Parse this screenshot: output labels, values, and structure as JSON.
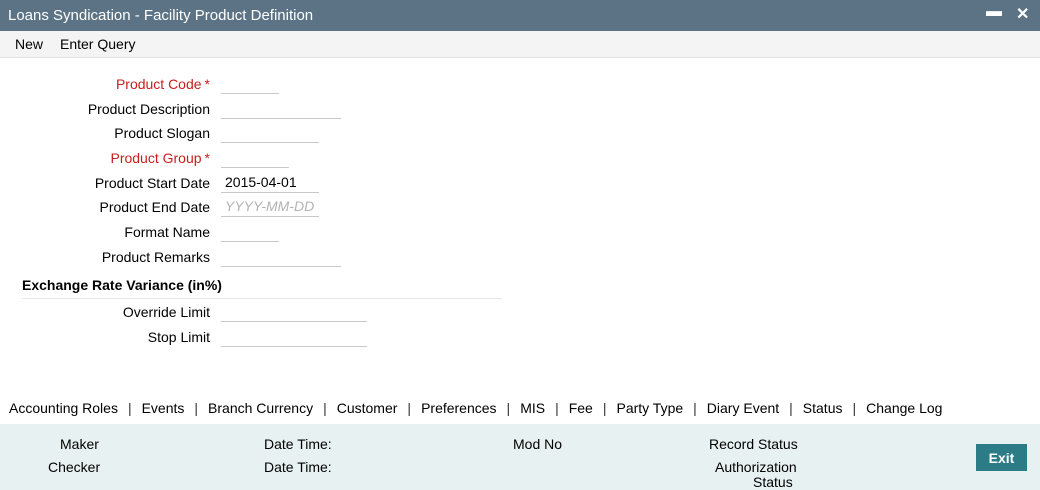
{
  "window": {
    "title": "Loans Syndication - Facility Product Definition",
    "minimize_glyph": "▬",
    "close_glyph": "✕"
  },
  "menu": {
    "new": "New",
    "enter_query": "Enter Query"
  },
  "form": {
    "product_code": {
      "label": "Product Code",
      "value": ""
    },
    "product_description": {
      "label": "Product Description",
      "value": ""
    },
    "product_slogan": {
      "label": "Product Slogan",
      "value": ""
    },
    "product_group": {
      "label": "Product Group",
      "value": ""
    },
    "product_start_date": {
      "label": "Product Start Date",
      "value": "2015-04-01"
    },
    "product_end_date": {
      "label": "Product End Date",
      "value": "",
      "placeholder": "YYYY-MM-DD"
    },
    "format_name": {
      "label": "Format Name",
      "value": ""
    },
    "product_remarks": {
      "label": "Product Remarks",
      "value": ""
    },
    "mandatory_marker": "*"
  },
  "exchange_rate": {
    "title": "Exchange Rate Variance (in%)",
    "override_limit": {
      "label": "Override Limit",
      "value": ""
    },
    "stop_limit": {
      "label": "Stop Limit",
      "value": ""
    }
  },
  "tabs": [
    "Accounting Roles",
    "Events",
    "Branch Currency",
    "Customer",
    "Preferences",
    "MIS",
    "Fee",
    "Party Type",
    "Diary Event",
    "Status",
    "Change Log"
  ],
  "tab_separator": "|",
  "footer": {
    "maker": "Maker",
    "checker": "Checker",
    "date_time_1": "Date Time:",
    "date_time_2": "Date Time:",
    "mod_no": "Mod No",
    "record_status": "Record Status",
    "authorization": "Authorization",
    "status": "Status",
    "exit": "Exit"
  },
  "colors": {
    "titlebar": "#5b7384",
    "mandatory_label": "#c81e1e",
    "footer_bg": "#e8f1f2",
    "exit_button": "#2b7c87"
  }
}
